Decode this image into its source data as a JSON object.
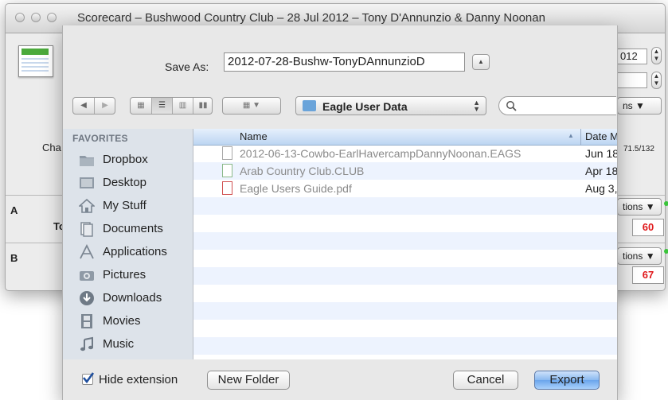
{
  "background_window": {
    "title": "Scorecard – Bushwood Country Club – 28 Jul 2012 – Tony D'Annunzio & Danny Noonan",
    "partial_year": "012",
    "partial_options": "ns",
    "partial_label_cha": "Cha",
    "partial_slope": "71.5/132",
    "row_a_label": "A",
    "row_a_sub": "To",
    "row_a_options": "tions",
    "row_a_score": "60",
    "row_b_label": "B",
    "row_b_options": "tions",
    "row_b_score": "67"
  },
  "save_dialog": {
    "save_as_label": "Save As:",
    "filename": "2012-07-28-Bushw-TonyDAnnunzioD",
    "location": "Eagle User Data",
    "search_placeholder": ""
  },
  "sidebar": {
    "header": "FAVORITES",
    "items": [
      {
        "label": "Dropbox",
        "icon": "dropbox-folder-icon"
      },
      {
        "label": "Desktop",
        "icon": "desktop-icon"
      },
      {
        "label": "My Stuff",
        "icon": "home-icon"
      },
      {
        "label": "Documents",
        "icon": "documents-icon"
      },
      {
        "label": "Applications",
        "icon": "applications-icon"
      },
      {
        "label": "Pictures",
        "icon": "pictures-icon"
      },
      {
        "label": "Downloads",
        "icon": "downloads-icon"
      },
      {
        "label": "Movies",
        "icon": "movies-icon"
      },
      {
        "label": "Music",
        "icon": "music-icon"
      }
    ]
  },
  "file_list": {
    "columns": {
      "name": "Name",
      "date": "Date M"
    },
    "files": [
      {
        "name": "2012-06-13-Cowbo-EarlHavercampDannyNoonan.EAGS",
        "date": "Jun 18,"
      },
      {
        "name": "Arab Country Club.CLUB",
        "date": "Apr 18"
      },
      {
        "name": "Eagle Users Guide.pdf",
        "date": "Aug 3,"
      }
    ]
  },
  "footer": {
    "hide_extension_label": "Hide extension",
    "hide_extension_checked": true,
    "new_folder_label": "New Folder",
    "cancel_label": "Cancel",
    "export_label": "Export"
  },
  "colors": {
    "accent": "#6aa5ec",
    "sidebar_bg": "#dde3ea",
    "score_red": "#e0181b"
  }
}
